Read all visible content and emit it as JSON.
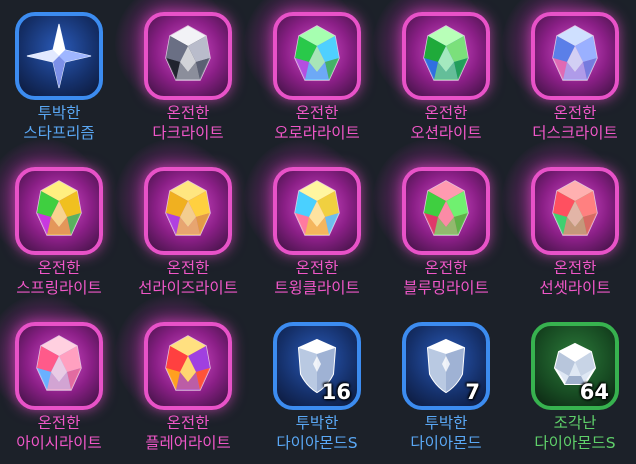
{
  "items": [
    {
      "line1": "투박한",
      "line2": "스타프리즘",
      "frame": "blue",
      "text_color": "#5aa8f5",
      "icon": "star-prism-icon",
      "count": null
    },
    {
      "line1": "온전한",
      "line2": "다크라이트",
      "frame": "pink",
      "text_color": "#f057c8",
      "icon": "dark-gem-icon",
      "count": null
    },
    {
      "line1": "온전한",
      "line2": "오로라라이트",
      "frame": "pink",
      "text_color": "#f057c8",
      "icon": "aurora-gem-icon",
      "count": null
    },
    {
      "line1": "온전한",
      "line2": "오션라이트",
      "frame": "pink",
      "text_color": "#f057c8",
      "icon": "ocean-gem-icon",
      "count": null
    },
    {
      "line1": "온전한",
      "line2": "더스크라이트",
      "frame": "pink",
      "text_color": "#f057c8",
      "icon": "dusk-gem-icon",
      "count": null
    },
    {
      "line1": "온전한",
      "line2": "스프링라이트",
      "frame": "pink",
      "text_color": "#f057c8",
      "icon": "spring-gem-icon",
      "count": null
    },
    {
      "line1": "온전한",
      "line2": "선라이즈라이트",
      "frame": "pink",
      "text_color": "#f057c8",
      "icon": "sunrise-gem-icon",
      "count": null
    },
    {
      "line1": "온전한",
      "line2": "트윙클라이트",
      "frame": "pink",
      "text_color": "#f057c8",
      "icon": "twinkle-gem-icon",
      "count": null
    },
    {
      "line1": "온전한",
      "line2": "블루밍라이트",
      "frame": "pink",
      "text_color": "#f057c8",
      "icon": "blooming-gem-icon",
      "count": null
    },
    {
      "line1": "온전한",
      "line2": "선셋라이트",
      "frame": "pink",
      "text_color": "#f057c8",
      "icon": "sunset-gem-icon",
      "count": null
    },
    {
      "line1": "온전한",
      "line2": "아이시라이트",
      "frame": "pink",
      "text_color": "#f057c8",
      "icon": "icy-gem-icon",
      "count": null
    },
    {
      "line1": "온전한",
      "line2": "플레어라이트",
      "frame": "pink",
      "text_color": "#f057c8",
      "icon": "flare-gem-icon",
      "count": null
    },
    {
      "line1": "투박한",
      "line2": "다이아몬드S",
      "frame": "blue",
      "text_color": "#5aa8f5",
      "icon": "diamond-s-shield-icon",
      "count": "16"
    },
    {
      "line1": "투박한",
      "line2": "다이아몬드",
      "frame": "blue",
      "text_color": "#5aa8f5",
      "icon": "diamond-shield-icon",
      "count": "7"
    },
    {
      "line1": "조각난",
      "line2": "다이아몬드S",
      "frame": "green",
      "text_color": "#5fd06a",
      "icon": "broken-diamond-s-icon",
      "count": "64"
    }
  ]
}
